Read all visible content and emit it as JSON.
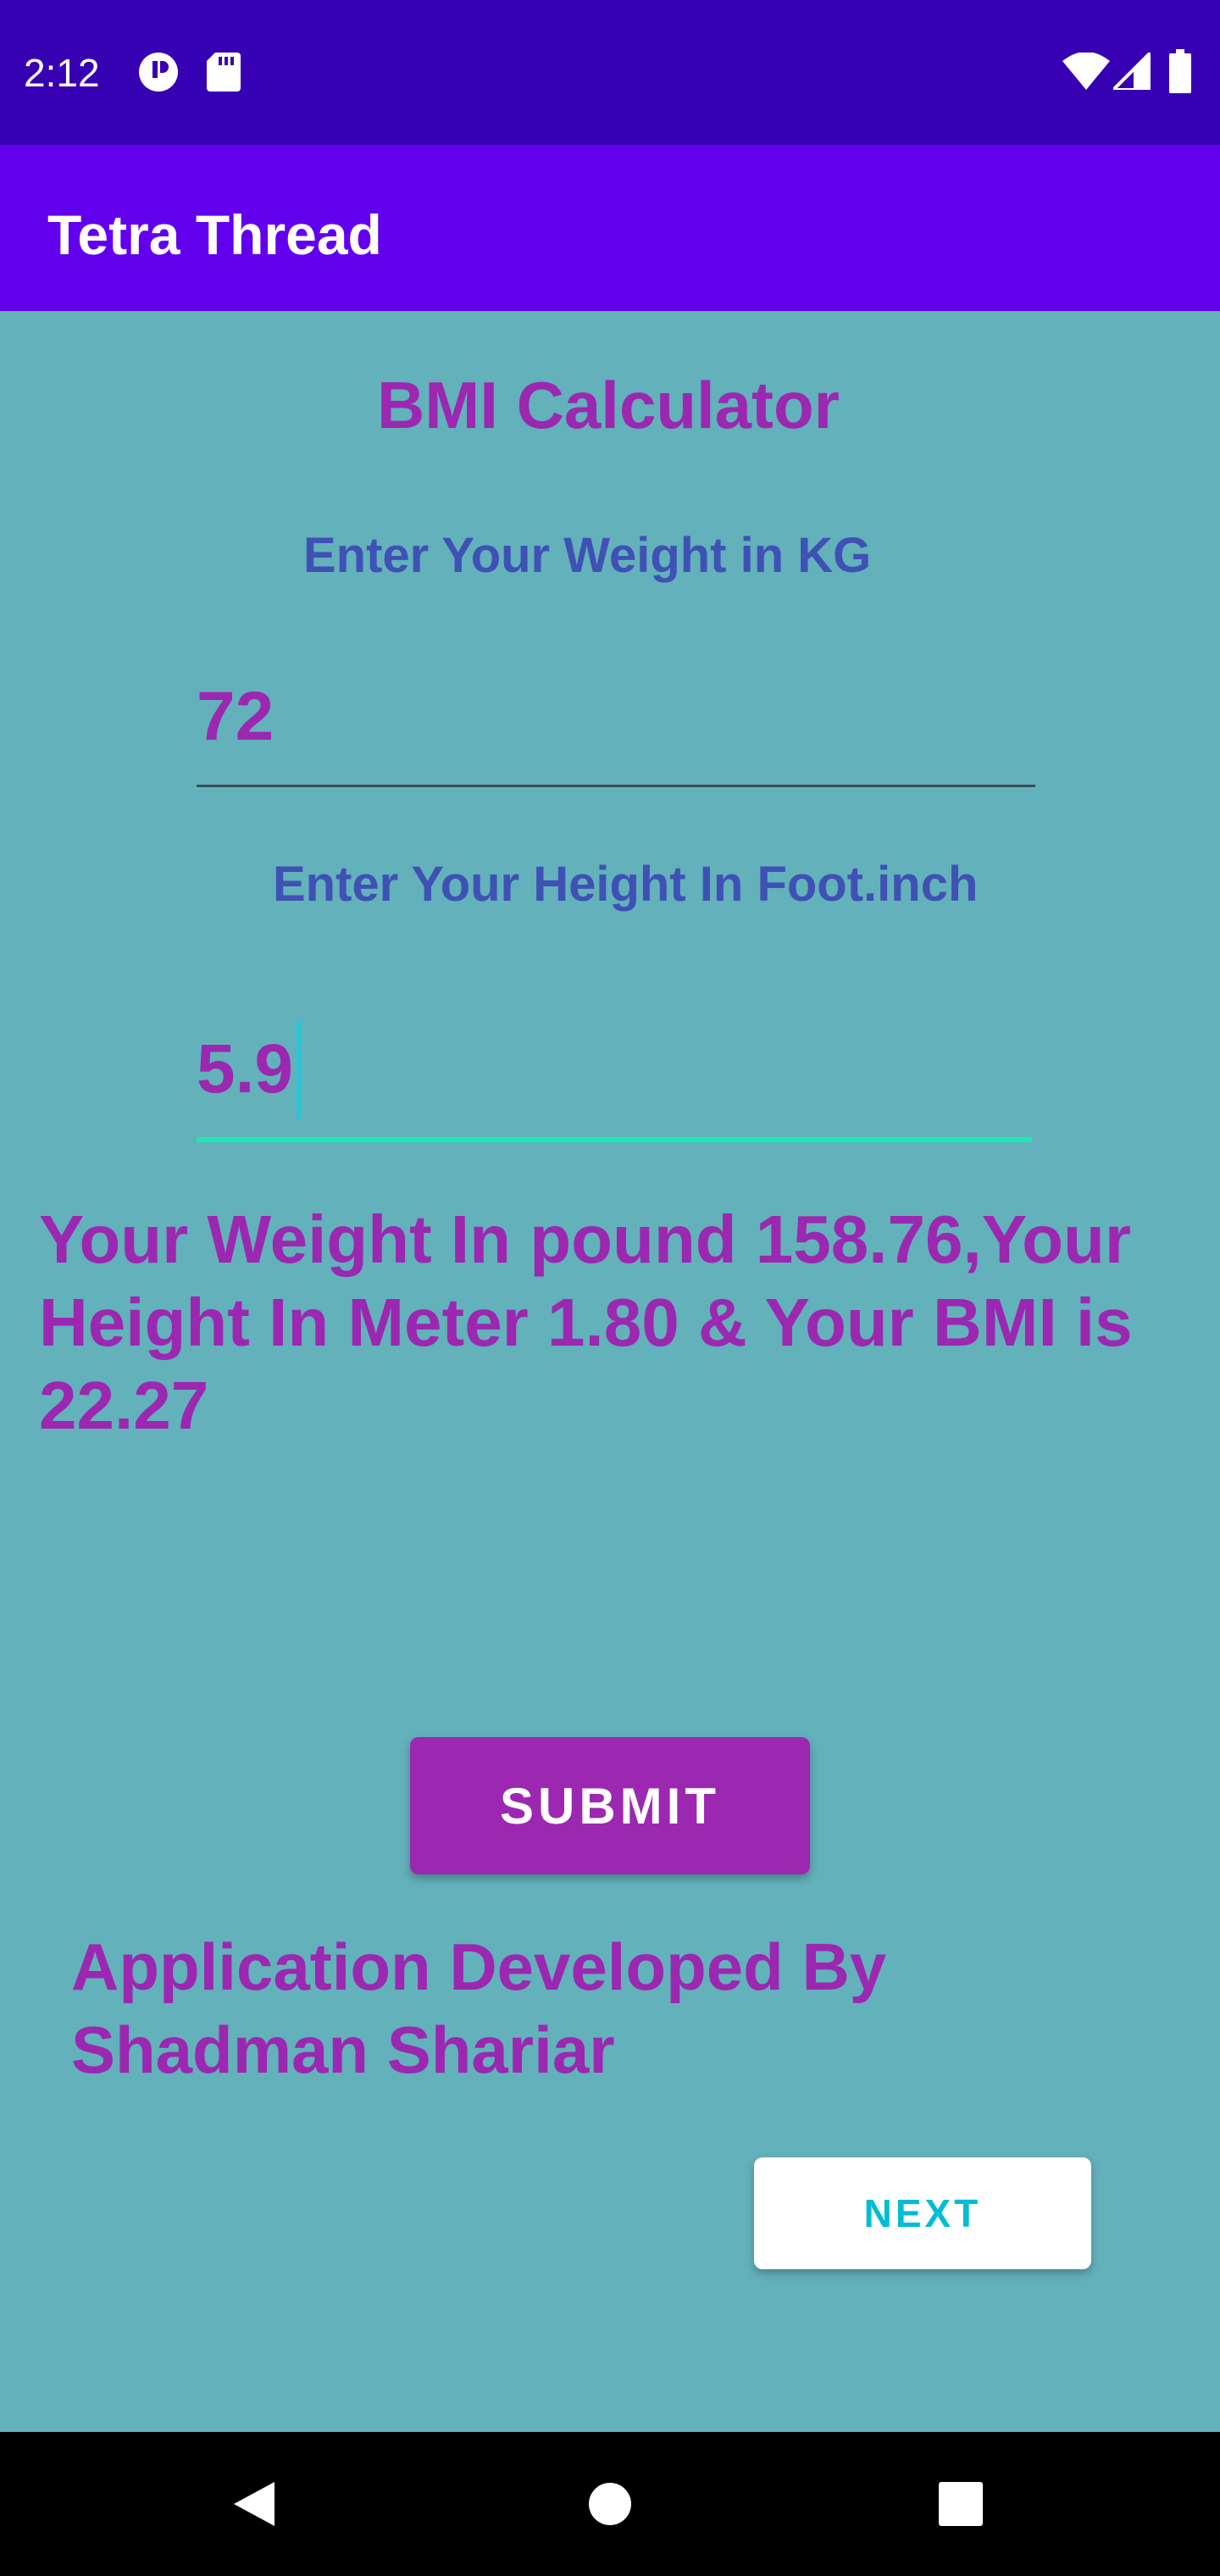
{
  "status_bar": {
    "time": "2:12",
    "left_icons": [
      "notification-app-icon",
      "sd-card-icon"
    ],
    "right_icons": [
      "wifi-icon",
      "cellular-signal-icon",
      "battery-icon"
    ]
  },
  "app_bar": {
    "title": "Tetra Thread"
  },
  "form": {
    "heading": "BMI Calculator",
    "weight_label": "Enter Your Weight in KG",
    "weight_value": "72",
    "height_label": "Enter Your Height In Foot.inch",
    "height_value": "5.9"
  },
  "result_text": "Your Weight In pound 158.76,Your Height In Meter 1.80 & Your BMI is 22.27",
  "submit_label": "SUBMIT",
  "credit_text": "Application Developed By Shadman Shariar",
  "next_label": "NEXT",
  "nav_bar": {
    "buttons": [
      "back-icon",
      "home-icon",
      "recents-icon"
    ]
  },
  "colors": {
    "status_bar": "#3700b3",
    "app_bar": "#6200ee",
    "background": "#63b1bb",
    "accent_purple": "#9c27b0",
    "label_blue": "#3f51b5",
    "next_text": "#00bcd4"
  }
}
